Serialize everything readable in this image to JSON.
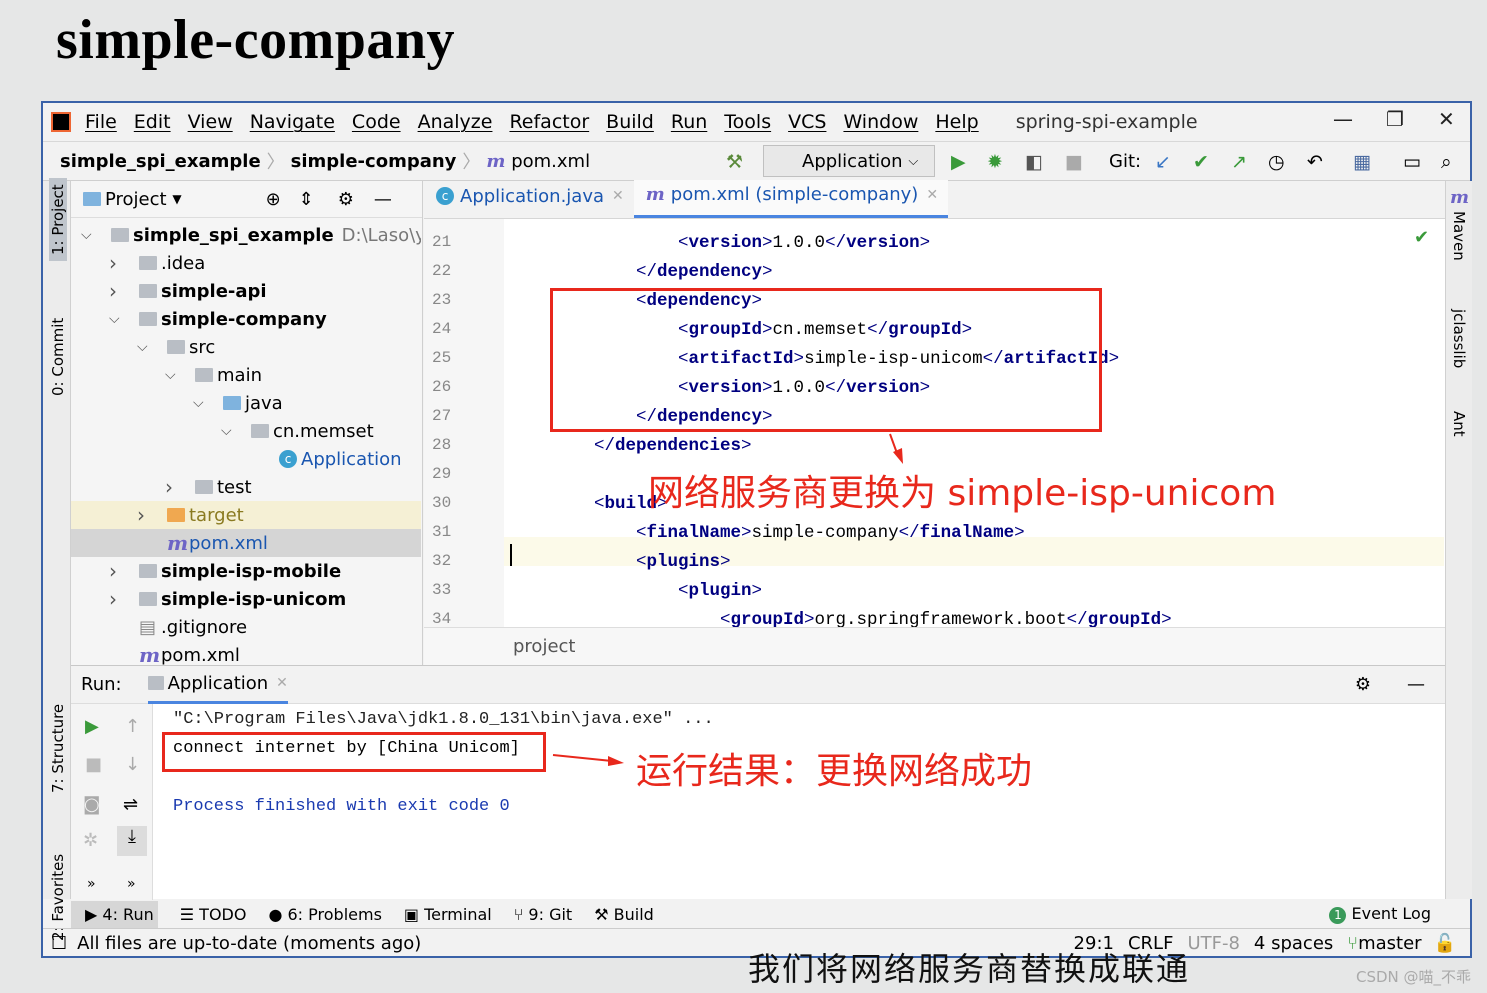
{
  "slide_title": "simple-company",
  "subtitle": "我们将网络服务商替换成联通",
  "watermark": "CSDN @喵_不乖",
  "menu": [
    "File",
    "Edit",
    "View",
    "Navigate",
    "Code",
    "Analyze",
    "Refactor",
    "Build",
    "Run",
    "Tools",
    "VCS",
    "Window",
    "Help"
  ],
  "project_name": "spring-spi-example",
  "nav": {
    "crumbs": [
      "simple_spi_example",
      "simple-company"
    ],
    "file": "pom.xml",
    "run_config": "Application",
    "git_label": "Git:"
  },
  "left_strip": [
    "1: Project",
    "0: Commit",
    "7: Structure",
    "2: Favorites"
  ],
  "right_strip": [
    "Maven",
    "jclasslib",
    "Ant"
  ],
  "project_panel": {
    "title": "Project",
    "tree": [
      {
        "label": "simple_spi_example",
        "extra": "D:\\Laso\\ysspa",
        "bold": true,
        "depth": 0,
        "arrow": "down",
        "icon": "module"
      },
      {
        "label": ".idea",
        "depth": 1,
        "arrow": "right",
        "icon": "folder"
      },
      {
        "label": "simple-api",
        "bold": true,
        "depth": 1,
        "arrow": "right",
        "icon": "module"
      },
      {
        "label": "simple-company",
        "bold": true,
        "depth": 1,
        "arrow": "down",
        "icon": "module"
      },
      {
        "label": "src",
        "depth": 2,
        "arrow": "down",
        "icon": "folder"
      },
      {
        "label": "main",
        "depth": 3,
        "arrow": "down",
        "icon": "folder"
      },
      {
        "label": "java",
        "depth": 4,
        "arrow": "down",
        "icon": "folder-blue"
      },
      {
        "label": "cn.memset",
        "depth": 5,
        "arrow": "down",
        "icon": "package"
      },
      {
        "label": "Application",
        "depth": 6,
        "arrow": "",
        "icon": "class",
        "blue": true
      },
      {
        "label": "test",
        "depth": 3,
        "arrow": "right",
        "icon": "folder"
      },
      {
        "label": "target",
        "depth": 2,
        "arrow": "right",
        "icon": "folder-orange",
        "olive": true
      },
      {
        "label": "pom.xml",
        "depth": 2,
        "arrow": "",
        "icon": "maven",
        "blue": true,
        "selected": true
      },
      {
        "label": "simple-isp-mobile",
        "bold": true,
        "depth": 1,
        "arrow": "right",
        "icon": "module"
      },
      {
        "label": "simple-isp-unicom",
        "bold": true,
        "depth": 1,
        "arrow": "right",
        "icon": "module"
      },
      {
        "label": ".gitignore",
        "depth": 1,
        "arrow": "",
        "icon": "file"
      },
      {
        "label": "pom.xml",
        "depth": 1,
        "arrow": "",
        "icon": "maven"
      }
    ]
  },
  "editor": {
    "tabs": [
      {
        "label": "Application.java",
        "icon": "class"
      },
      {
        "label": "pom.xml (simple-company)",
        "icon": "maven",
        "active": true
      }
    ],
    "lines": [
      {
        "n": "21",
        "indent": 3,
        "tok": [
          [
            "t",
            "<"
          ],
          [
            "n",
            "version"
          ],
          [
            "t",
            ">"
          ],
          [
            "x",
            "1.0.0"
          ],
          [
            "t",
            "</"
          ],
          [
            "n",
            "version"
          ],
          [
            "t",
            ">"
          ]
        ]
      },
      {
        "n": "22",
        "indent": 2,
        "tok": [
          [
            "t",
            "</"
          ],
          [
            "n",
            "dependency"
          ],
          [
            "t",
            ">"
          ]
        ]
      },
      {
        "n": "23",
        "indent": 2,
        "tok": [
          [
            "t",
            "<"
          ],
          [
            "n",
            "dependency"
          ],
          [
            "t",
            ">"
          ]
        ]
      },
      {
        "n": "24",
        "indent": 3,
        "tok": [
          [
            "t",
            "<"
          ],
          [
            "n",
            "groupId"
          ],
          [
            "t",
            ">"
          ],
          [
            "x",
            "cn.memset"
          ],
          [
            "t",
            "</"
          ],
          [
            "n",
            "groupId"
          ],
          [
            "t",
            ">"
          ]
        ]
      },
      {
        "n": "25",
        "indent": 3,
        "tok": [
          [
            "t",
            "<"
          ],
          [
            "n",
            "artifactId"
          ],
          [
            "t",
            ">"
          ],
          [
            "x",
            "simple-isp-unicom"
          ],
          [
            "t",
            "</"
          ],
          [
            "n",
            "artifactId"
          ],
          [
            "t",
            ">"
          ]
        ]
      },
      {
        "n": "26",
        "indent": 3,
        "tok": [
          [
            "t",
            "<"
          ],
          [
            "n",
            "version"
          ],
          [
            "t",
            ">"
          ],
          [
            "x",
            "1.0.0"
          ],
          [
            "t",
            "</"
          ],
          [
            "n",
            "version"
          ],
          [
            "t",
            ">"
          ]
        ]
      },
      {
        "n": "27",
        "indent": 2,
        "tok": [
          [
            "t",
            "</"
          ],
          [
            "n",
            "dependency"
          ],
          [
            "t",
            ">"
          ]
        ]
      },
      {
        "n": "28",
        "indent": 1,
        "tok": [
          [
            "t",
            "</"
          ],
          [
            "n",
            "dependencies"
          ],
          [
            "t",
            ">"
          ]
        ]
      },
      {
        "n": "29",
        "indent": 0,
        "tok": []
      },
      {
        "n": "30",
        "indent": 1,
        "tok": [
          [
            "t",
            "<"
          ],
          [
            "n",
            "build"
          ],
          [
            "t",
            ">"
          ]
        ]
      },
      {
        "n": "31",
        "indent": 2,
        "tok": [
          [
            "t",
            "<"
          ],
          [
            "n",
            "finalName"
          ],
          [
            "t",
            ">"
          ],
          [
            "x",
            "simple-company"
          ],
          [
            "t",
            "</"
          ],
          [
            "n",
            "finalName"
          ],
          [
            "t",
            ">"
          ]
        ]
      },
      {
        "n": "32",
        "indent": 2,
        "tok": [
          [
            "t",
            "<"
          ],
          [
            "n",
            "plugins"
          ],
          [
            "t",
            ">"
          ]
        ]
      },
      {
        "n": "33",
        "indent": 3,
        "tok": [
          [
            "t",
            "<"
          ],
          [
            "n",
            "plugin"
          ],
          [
            "t",
            ">"
          ]
        ]
      },
      {
        "n": "34",
        "indent": 4,
        "tok": [
          [
            "t",
            "<"
          ],
          [
            "n",
            "groupId"
          ],
          [
            "t",
            ">"
          ],
          [
            "x",
            "org.springframework.boot"
          ],
          [
            "t",
            "</"
          ],
          [
            "n",
            "groupId"
          ],
          [
            "t",
            ">"
          ]
        ]
      }
    ],
    "breadcrumb": "project",
    "annotation": "网络服务商更换为 simple-isp-unicom"
  },
  "run": {
    "label": "Run:",
    "tab": "Application",
    "console": [
      "\"C:\\Program Files\\Java\\jdk1.8.0_131\\bin\\java.exe\" ...",
      "connect internet by [China Unicom]",
      "Process finished with exit code 0"
    ],
    "annotation": "运行结果：更换网络成功"
  },
  "bottom_tools": [
    "4: Run",
    "TODO",
    "6: Problems",
    "Terminal",
    "9: Git",
    "Build"
  ],
  "event_log": "Event Log",
  "event_count": "1",
  "status": {
    "message": "All files are up-to-date (moments ago)",
    "position": "29:1",
    "line_sep": "CRLF",
    "encoding": "UTF-8",
    "indent": "4 spaces",
    "branch": "master"
  },
  "colors": {
    "annotation": "#e8281c",
    "tag": "#000080",
    "accent": "#4a85e0"
  }
}
